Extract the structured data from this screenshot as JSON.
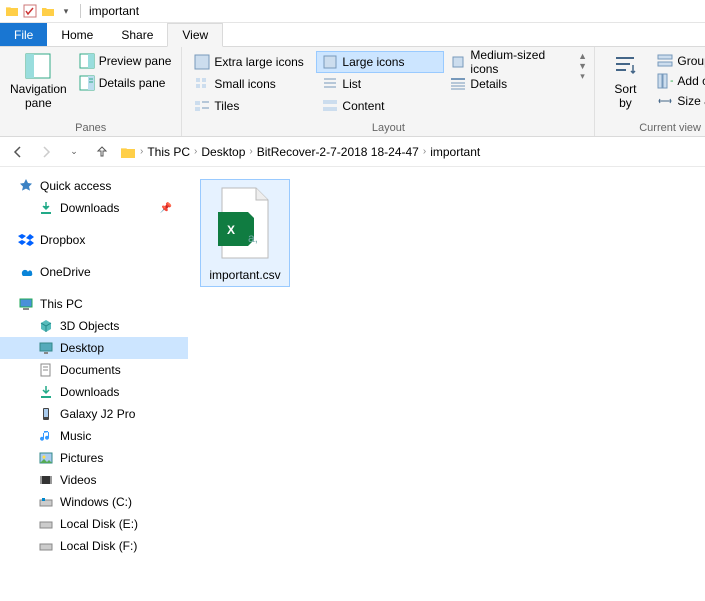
{
  "title": "important",
  "menu": {
    "file": "File",
    "home": "Home",
    "share": "Share",
    "view": "View"
  },
  "ribbon": {
    "panes": {
      "navPane": "Navigation\npane",
      "preview": "Preview pane",
      "details": "Details pane",
      "label": "Panes"
    },
    "views": {
      "xl": "Extra large icons",
      "lg": "Large icons",
      "md": "Medium-sized icons",
      "sm": "Small icons",
      "list": "List",
      "details": "Details",
      "tiles": "Tiles",
      "content": "Content",
      "label": "Layout"
    },
    "sort": "Sort\nby",
    "currentview": {
      "group": "Group by",
      "addcol": "Add colum",
      "sizeall": "Size all col",
      "label": "Current view"
    }
  },
  "breadcrumb": [
    "This PC",
    "Desktop",
    "BitRecover-2-7-2018 18-24-47",
    "important"
  ],
  "sidebar": {
    "quick": "Quick access",
    "downloads": "Downloads",
    "dropbox": "Dropbox",
    "onedrive": "OneDrive",
    "thispc": "This PC",
    "children": {
      "obj3d": "3D Objects",
      "desktop": "Desktop",
      "documents": "Documents",
      "downloads": "Downloads",
      "galaxy": "Galaxy J2 Pro",
      "music": "Music",
      "pictures": "Pictures",
      "videos": "Videos",
      "winc": "Windows (C:)",
      "diske": "Local Disk (E:)",
      "diskf": "Local Disk (F:)"
    }
  },
  "file": {
    "name": "important.csv"
  }
}
